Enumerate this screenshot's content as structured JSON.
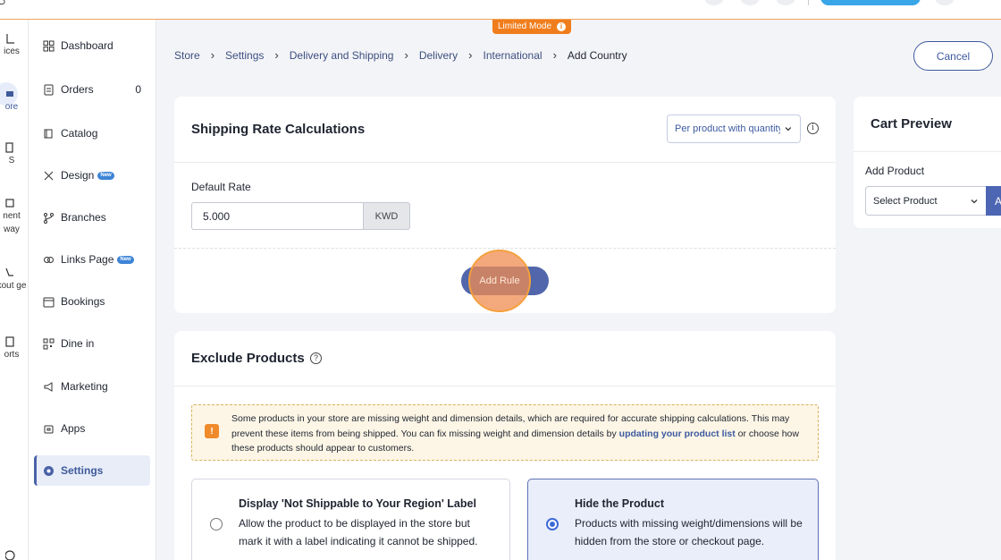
{
  "app": {
    "limited_mode": "Limited Mode"
  },
  "rail": {
    "items": [
      {
        "label": "ices",
        "icon": "invoice-icon"
      },
      {
        "label": "ore",
        "icon": "store-icon"
      },
      {
        "label": "S",
        "icon": "pos-icon"
      },
      {
        "label": "nent way",
        "icon": "payment-gateway-icon"
      },
      {
        "label": "kout ge",
        "icon": "checkout-icon"
      },
      {
        "label": "orts",
        "icon": "reports-icon"
      }
    ]
  },
  "sidebar": {
    "items": [
      {
        "label": "Dashboard",
        "icon": "dashboard-icon"
      },
      {
        "label": "Orders",
        "icon": "orders-icon",
        "count": "0"
      },
      {
        "label": "Catalog",
        "icon": "catalog-icon"
      },
      {
        "label": "Design",
        "icon": "design-icon",
        "badge": "New"
      },
      {
        "label": "Branches",
        "icon": "branches-icon"
      },
      {
        "label": "Links Page",
        "icon": "links-icon",
        "badge": "New"
      },
      {
        "label": "Bookings",
        "icon": "calendar-icon"
      },
      {
        "label": "Dine in",
        "icon": "qr-icon"
      },
      {
        "label": "Marketing",
        "icon": "megaphone-icon"
      },
      {
        "label": "Apps",
        "icon": "apps-icon"
      },
      {
        "label": "Settings",
        "icon": "gear-icon",
        "active": true
      }
    ]
  },
  "breadcrumb": {
    "items": [
      "Store",
      "Settings",
      "Delivery and Shipping",
      "Delivery",
      "International"
    ],
    "current": "Add Country"
  },
  "header": {
    "cancel_label": "Cancel"
  },
  "rates": {
    "title": "Shipping Rate Calculations",
    "method_selected": "Per product with quantity",
    "default_rate_label": "Default Rate",
    "default_rate_value": "5.000",
    "currency": "KWD",
    "add_rule_label": "Add Rule"
  },
  "exclude": {
    "title": "Exclude Products",
    "warning_text": "Some products in your store are missing weight and dimension details, which are required for accurate shipping calculations. This may prevent these items from being shipped. You can fix missing weight and dimension details by ",
    "warning_link": "updating your product list",
    "warning_tail": " or choose how these products should appear to customers.",
    "options": [
      {
        "title": "Display 'Not Shippable to Your Region' Label",
        "desc": "Allow the product to be displayed in the store but mark it with a label indicating it cannot be shipped.",
        "selected": false
      },
      {
        "title": "Hide the Product",
        "desc": "Products with missing weight/dimensions will be hidden from the store or checkout page.",
        "selected": true
      }
    ]
  },
  "cart_preview": {
    "title": "Cart Preview",
    "add_product_label": "Add Product",
    "select_placeholder": "Select Product",
    "add_button": "A"
  },
  "colors": {
    "accent": "#4c66b3",
    "limited": "#f07d1c",
    "warning_bg": "#fdf6e6"
  }
}
